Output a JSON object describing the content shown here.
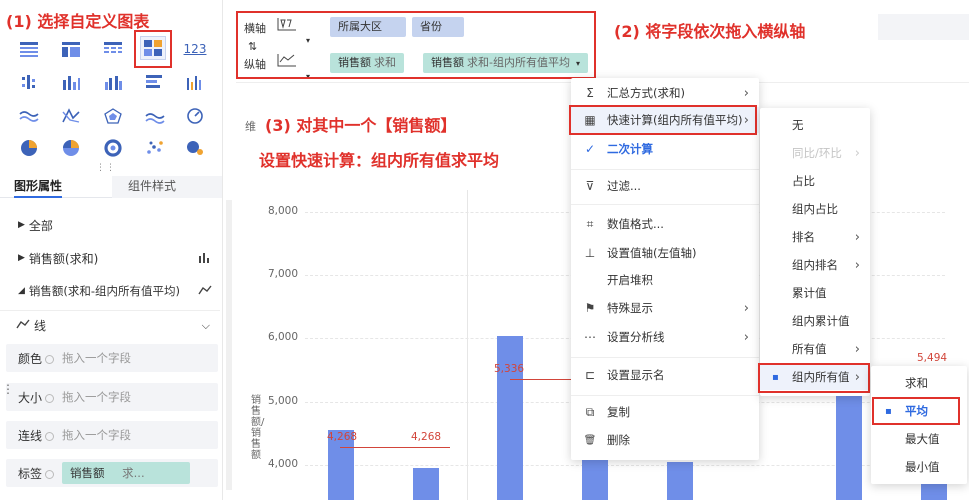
{
  "annotations": {
    "step1": "(1) 选择自定义图表",
    "step2": "(2) 将字段依次拖入横纵轴",
    "step3_line1": "(3) 对其中一个【销售额】",
    "step3_line2": "设置快速计算：组内所有值求平均"
  },
  "left_panel": {
    "chart_icon_label_123": "123",
    "tabs": [
      "图形属性",
      "组件样式"
    ],
    "tab_dots": "⋮⋮",
    "props": {
      "all": "全部",
      "sum_sales": "销售额(求和)",
      "avg_sales": "销售额(求和-组内所有值平均)",
      "line_type": "线"
    },
    "fields": [
      {
        "label": "颜色",
        "placeholder": "拖入一个字段"
      },
      {
        "label": "大小",
        "placeholder": "拖入一个字段"
      },
      {
        "label": "连线",
        "placeholder": "拖入一个字段"
      },
      {
        "label": "标签",
        "value": "销售额",
        "extra": "求..."
      }
    ]
  },
  "axis": {
    "horizontal_label": "横轴",
    "vertical_label": "纵轴",
    "h_fields": [
      "所属大区",
      "省份"
    ],
    "v_fields": [
      {
        "name": "销售额",
        "agg": "求和"
      },
      {
        "name": "销售额",
        "agg": "求和-组内所有值平均"
      }
    ]
  },
  "chart": {
    "axis_label": "销售额/销售额",
    "title_partial": "维",
    "yticks": [
      "8,000",
      "7,000",
      "6,000",
      "5,000",
      "4,000"
    ],
    "value_labels": [
      "4,268",
      "4,268",
      "5,336",
      "5,494"
    ]
  },
  "menu1": {
    "items": [
      {
        "icon": "Σ",
        "label": "汇总方式(求和)",
        "arrow": true
      },
      {
        "icon": "▦",
        "label": "快速计算(组内所有值平均)",
        "arrow": true
      },
      {
        "icon": "✓",
        "label": "二次计算",
        "arrow": false
      },
      {
        "icon": "⊽",
        "label": "过滤...",
        "arrow": false
      },
      {
        "icon": "⌗",
        "label": "数值格式...",
        "arrow": false
      },
      {
        "icon": "⊥",
        "label": "设置值轴(左值轴)",
        "arrow": false
      },
      {
        "icon": "",
        "label": "开启堆积",
        "arrow": false
      },
      {
        "icon": "⚑",
        "label": "特殊显示",
        "arrow": true
      },
      {
        "icon": "⋯",
        "label": "设置分析线",
        "arrow": true
      },
      {
        "icon": "⊏",
        "label": "设置显示名",
        "arrow": false
      },
      {
        "icon": "⧉",
        "label": "复制",
        "arrow": false
      },
      {
        "icon": "🗑",
        "label": "删除",
        "arrow": false
      }
    ]
  },
  "menu2": {
    "items": [
      {
        "label": "无",
        "arrow": false
      },
      {
        "label": "同比/环比",
        "arrow": true
      },
      {
        "label": "占比",
        "arrow": false
      },
      {
        "label": "组内占比",
        "arrow": false
      },
      {
        "label": "排名",
        "arrow": true
      },
      {
        "label": "组内排名",
        "arrow": true
      },
      {
        "label": "累计值",
        "arrow": false
      },
      {
        "label": "组内累计值",
        "arrow": false
      },
      {
        "label": "所有值",
        "arrow": true
      },
      {
        "label": "组内所有值",
        "arrow": true
      }
    ]
  },
  "menu3": {
    "items": [
      {
        "label": "求和"
      },
      {
        "label": "平均"
      },
      {
        "label": "最大值"
      },
      {
        "label": "最小值"
      }
    ]
  },
  "colors": {
    "accent": "#e0312b",
    "bar": "#6f8ee8",
    "selected": "#2f6ae0"
  }
}
